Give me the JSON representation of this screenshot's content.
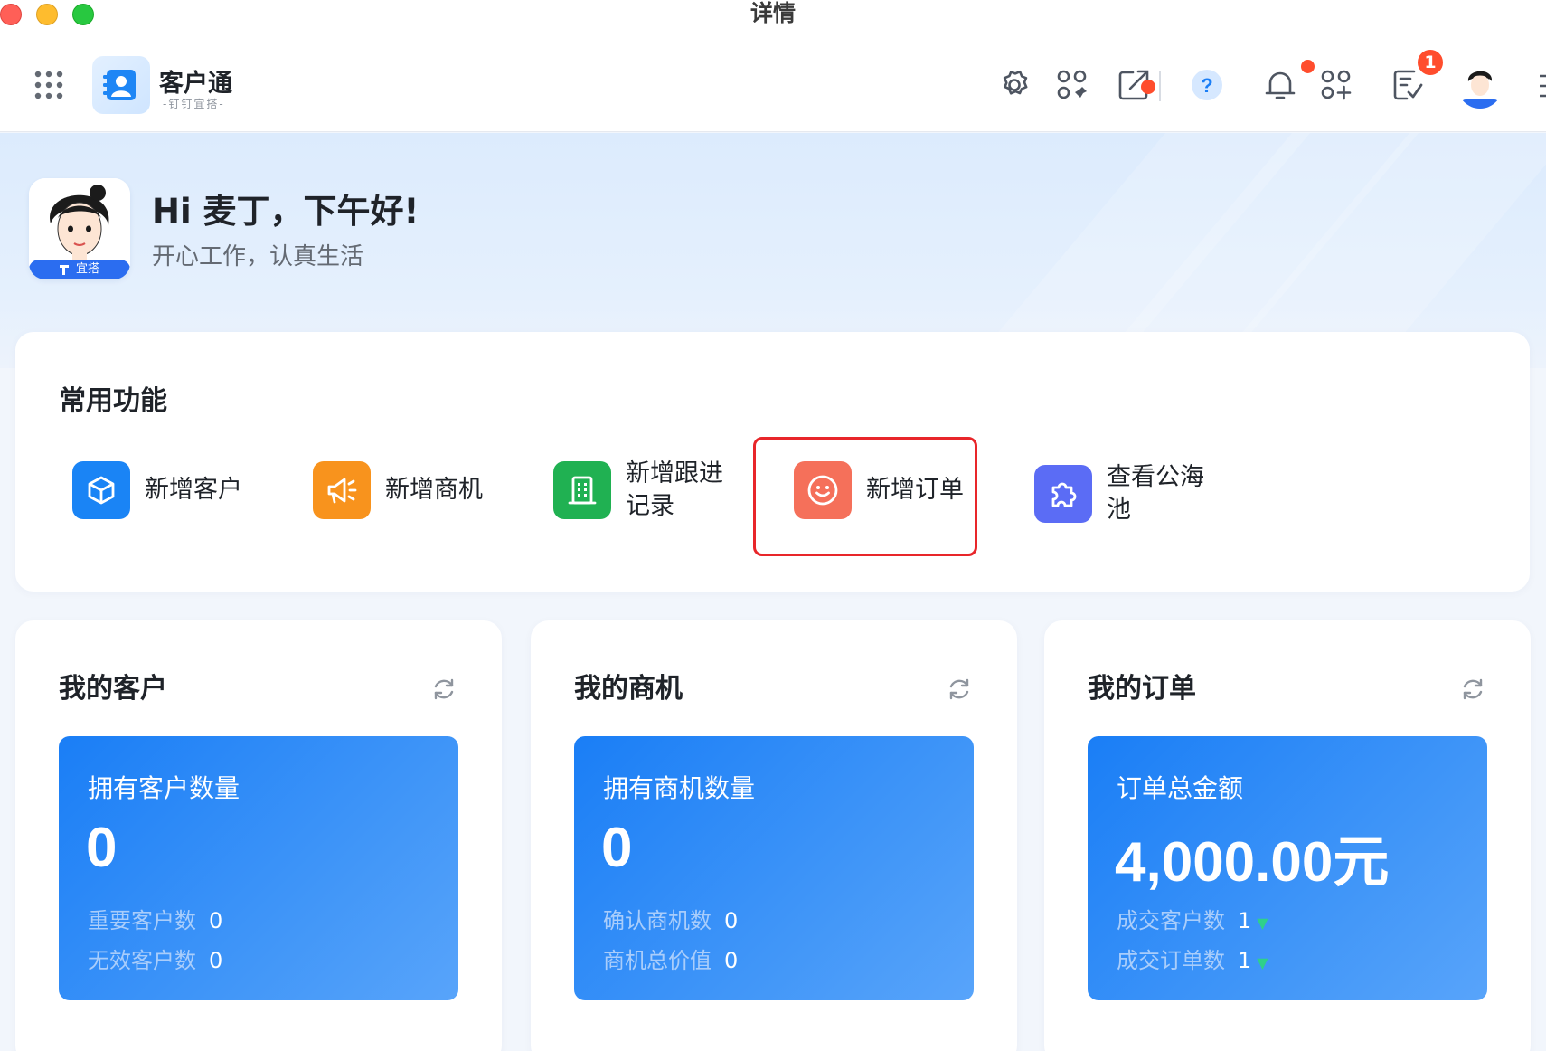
{
  "window": {
    "title": "详情"
  },
  "app": {
    "name": "客户通",
    "subtitle": "-钉钉宜搭-"
  },
  "topnav": {
    "icons": [
      "settings-icon",
      "apps-icon",
      "external-link-icon",
      "help-icon",
      "bell-icon",
      "add-app-icon",
      "todo-icon"
    ],
    "todo_badge": "1"
  },
  "hero": {
    "greeting": "Hi 麦丁，下午好!",
    "motto": "开心工作，认真生活",
    "avatar_badge": "宜搭"
  },
  "common": {
    "title": "常用功能",
    "items": [
      {
        "label": "新增客户",
        "icon": "cube-icon",
        "color": "#1a84f5"
      },
      {
        "label": "新增商机",
        "icon": "megaphone-icon",
        "color": "#f8931d"
      },
      {
        "label": "新增跟进\n记录",
        "icon": "building-icon",
        "color": "#20b152"
      },
      {
        "label": "新增订单",
        "icon": "smile-icon",
        "color": "#f5705a"
      },
      {
        "label": "查看公海\n池",
        "icon": "puzzle-icon",
        "color": "#5b6cf5"
      }
    ]
  },
  "stats": [
    {
      "title": "我的客户",
      "panel_label": "拥有客户数量",
      "value": "0",
      "rows": [
        {
          "label": "重要客户数",
          "value": "0"
        },
        {
          "label": "无效客户数",
          "value": "0"
        }
      ]
    },
    {
      "title": "我的商机",
      "panel_label": "拥有商机数量",
      "value": "0",
      "rows": [
        {
          "label": "确认商机数",
          "value": "0"
        },
        {
          "label": "商机总价值",
          "value": "0"
        }
      ]
    },
    {
      "title": "我的订单",
      "panel_label": "订单总金额",
      "value": "4,000.00元",
      "rows": [
        {
          "label": "成交客户数",
          "value": "1",
          "trend": "▼"
        },
        {
          "label": "成交订单数",
          "value": "1",
          "trend": "▼"
        }
      ]
    }
  ]
}
